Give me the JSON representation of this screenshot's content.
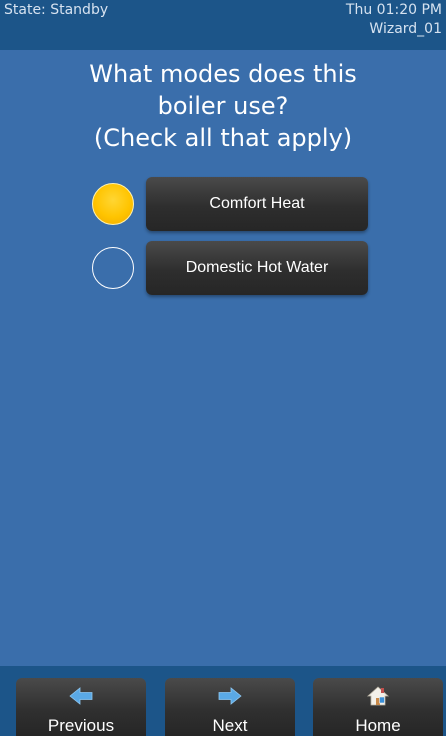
{
  "status": {
    "state": "State: Standby",
    "time": "Thu 01:20 PM",
    "screen": "Wizard_01"
  },
  "question": {
    "line1": "What modes does this",
    "line2": "boiler use?",
    "line3": "(Check all that apply)"
  },
  "options": [
    {
      "label": "Comfort Heat",
      "checked": true
    },
    {
      "label": "Domestic Hot Water",
      "checked": false
    }
  ],
  "nav": {
    "previous": "Previous",
    "next": "Next",
    "home": "Home"
  },
  "colors": {
    "background": "#3a6eab",
    "bars": "#1c5589",
    "checked_radio": "#ffc400",
    "arrow_icon": "#5aa9e6"
  },
  "icons": {
    "previous": "arrow-left-icon",
    "next": "arrow-right-icon",
    "home": "house-icon"
  }
}
